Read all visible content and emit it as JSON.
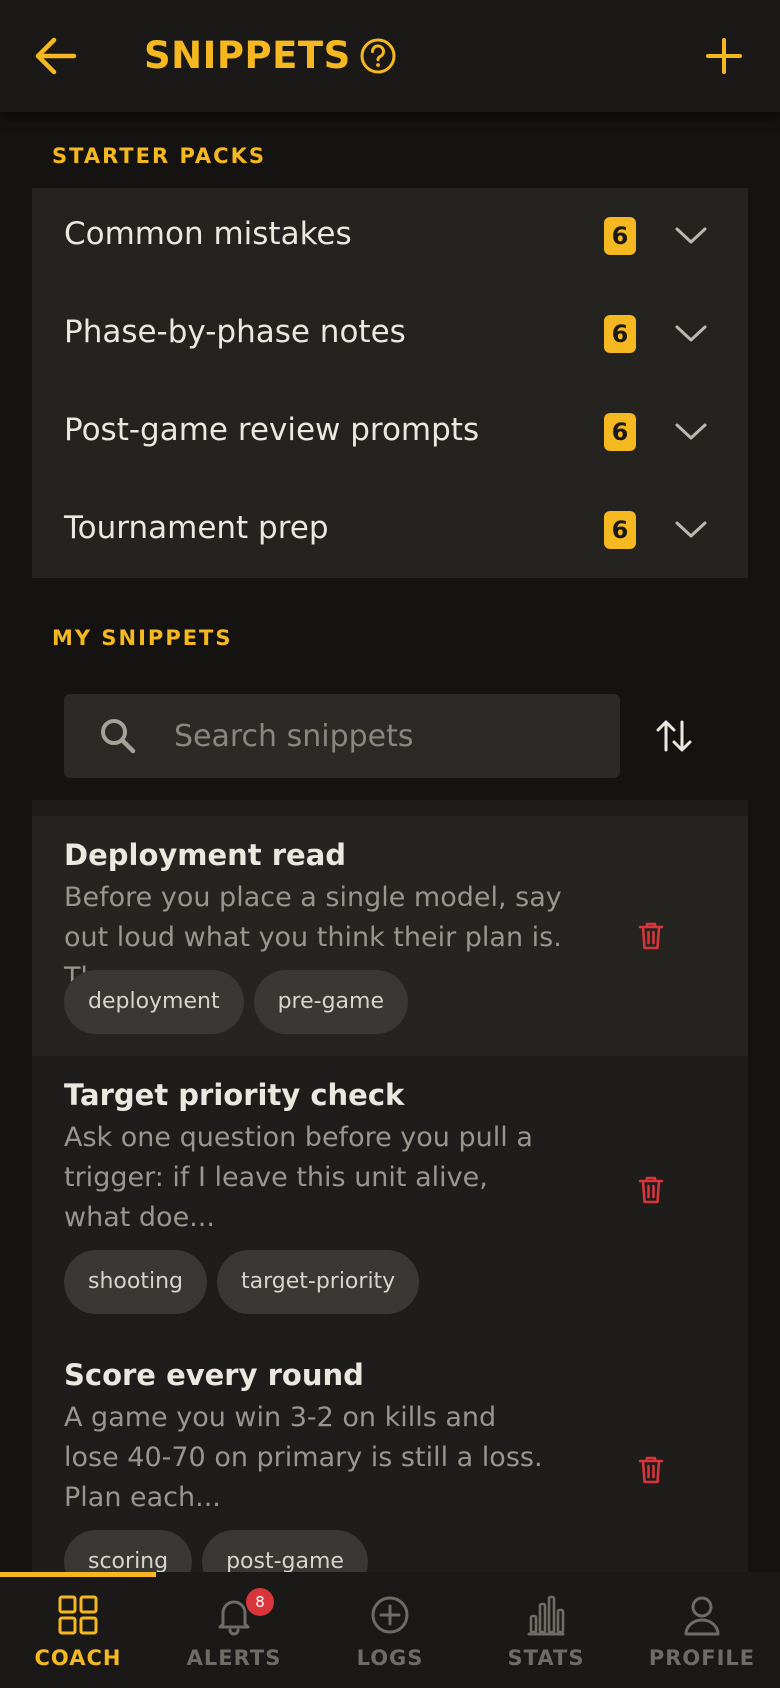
{
  "header": {
    "title": "SNIPPETS"
  },
  "starter_packs": {
    "label": "STARTER PACKS",
    "items": [
      {
        "name": "Common mistakes",
        "count": "6"
      },
      {
        "name": "Phase-by-phase notes",
        "count": "6"
      },
      {
        "name": "Post-game review prompts",
        "count": "6"
      },
      {
        "name": "Tournament prep",
        "count": "6"
      }
    ]
  },
  "my_snippets": {
    "label": "MY SNIPPETS",
    "search_placeholder": "Search snippets",
    "items": [
      {
        "title": "Deployment read",
        "body": "Before you place a single model, say out loud what you think their plan is. Then...",
        "tags": [
          "deployment",
          "pre-game"
        ]
      },
      {
        "title": "Target priority check",
        "body": "Ask one question before you pull a trigger: if I leave this unit alive, what doe...",
        "tags": [
          "shooting",
          "target-priority"
        ]
      },
      {
        "title": "Score every round",
        "body": "A game you win 3-2 on kills and lose 40-70 on primary is still a loss. Plan each...",
        "tags": [
          "scoring",
          "post-game"
        ]
      }
    ]
  },
  "nav": {
    "tabs": [
      {
        "label": "COACH",
        "icon": "grid-icon",
        "active": true
      },
      {
        "label": "ALERTS",
        "icon": "bell-icon",
        "badge": "8"
      },
      {
        "label": "LOGS",
        "icon": "plus-circle-icon"
      },
      {
        "label": "STATS",
        "icon": "bar-chart-icon"
      },
      {
        "label": "PROFILE",
        "icon": "person-icon"
      }
    ]
  },
  "colors": {
    "accent": "#f5b820",
    "danger": "#d8363a",
    "background": "#141311",
    "surface": "#252320"
  }
}
